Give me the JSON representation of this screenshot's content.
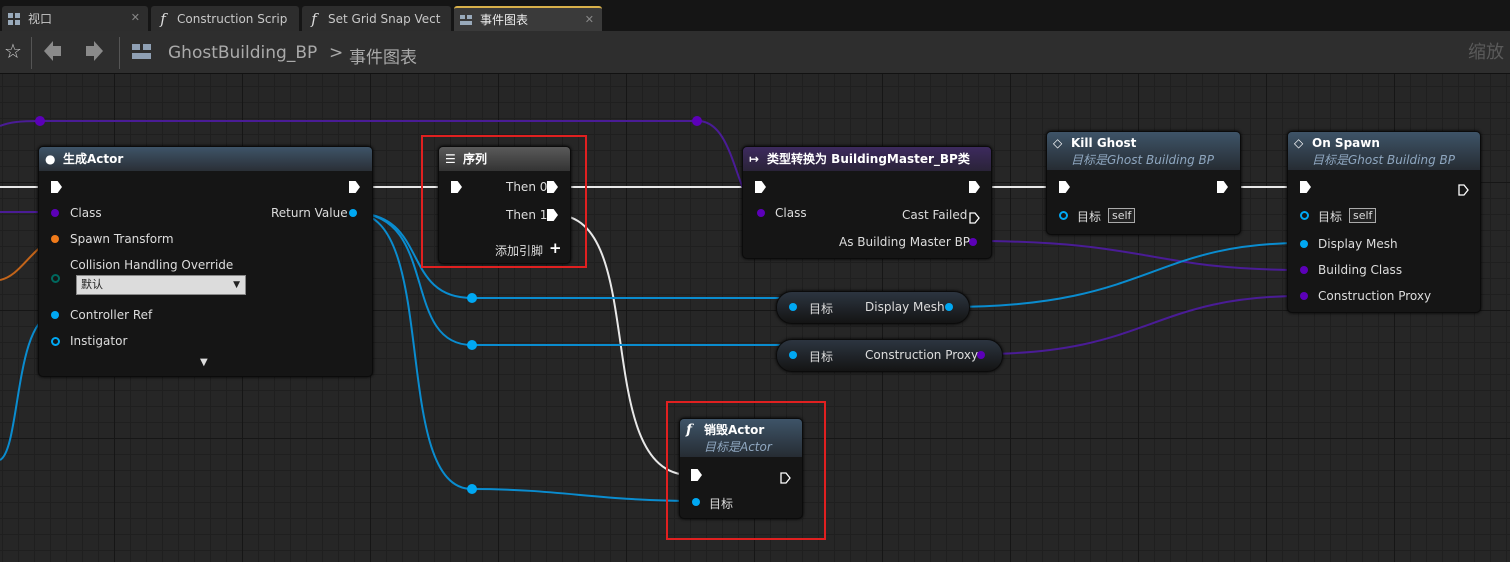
{
  "tabs": [
    {
      "label": "视口",
      "icon": "viewport-icon"
    },
    {
      "label": "Construction Scrip",
      "icon": "function-icon"
    },
    {
      "label": "Set Grid Snap Vect",
      "icon": "function-icon"
    },
    {
      "label": "事件图表",
      "icon": "event-graph-icon"
    }
  ],
  "breadcrumb": {
    "blueprint": "GhostBuilding_BP",
    "separator": ">",
    "graph": "事件图表"
  },
  "zoom_label": "缩放",
  "nodes": {
    "spawn_actor": {
      "title": "生成Actor",
      "pins": {
        "class": "Class",
        "spawn_transform": "Spawn Transform",
        "collision": "Collision Handling Override",
        "collision_value": "默认",
        "controller": "Controller Ref",
        "instigator": "Instigator",
        "return_value": "Return Value"
      }
    },
    "sequence": {
      "title": "序列",
      "then0": "Then 0",
      "then1": "Then 1",
      "add_pin": "添加引脚"
    },
    "cast": {
      "title": "类型转换为 BuildingMaster_BP类",
      "class": "Class",
      "cast_failed": "Cast Failed",
      "as_output": "As Building Master BP"
    },
    "kill_ghost": {
      "title": "Kill Ghost",
      "subtitle": "目标是Ghost Building BP",
      "target": "目标",
      "self": "self"
    },
    "on_spawn": {
      "title": "On Spawn",
      "subtitle": "目标是Ghost Building BP",
      "target": "目标",
      "self": "self",
      "display_mesh": "Display Mesh",
      "building_class": "Building Class",
      "construction_proxy": "Construction Proxy"
    },
    "get_display_mesh": {
      "target": "目标",
      "output": "Display Mesh"
    },
    "get_construction_proxy": {
      "target": "目标",
      "output": "Construction Proxy"
    },
    "destroy_actor": {
      "title": "销毁Actor",
      "subtitle": "目标是Actor",
      "target": "目标"
    }
  },
  "colors": {
    "exec": "#ffffff",
    "object": "#00a8f3",
    "class": "#5c00b8",
    "struct": "#f07a1a",
    "enum": "#00695f",
    "highlight": "#e02020"
  }
}
